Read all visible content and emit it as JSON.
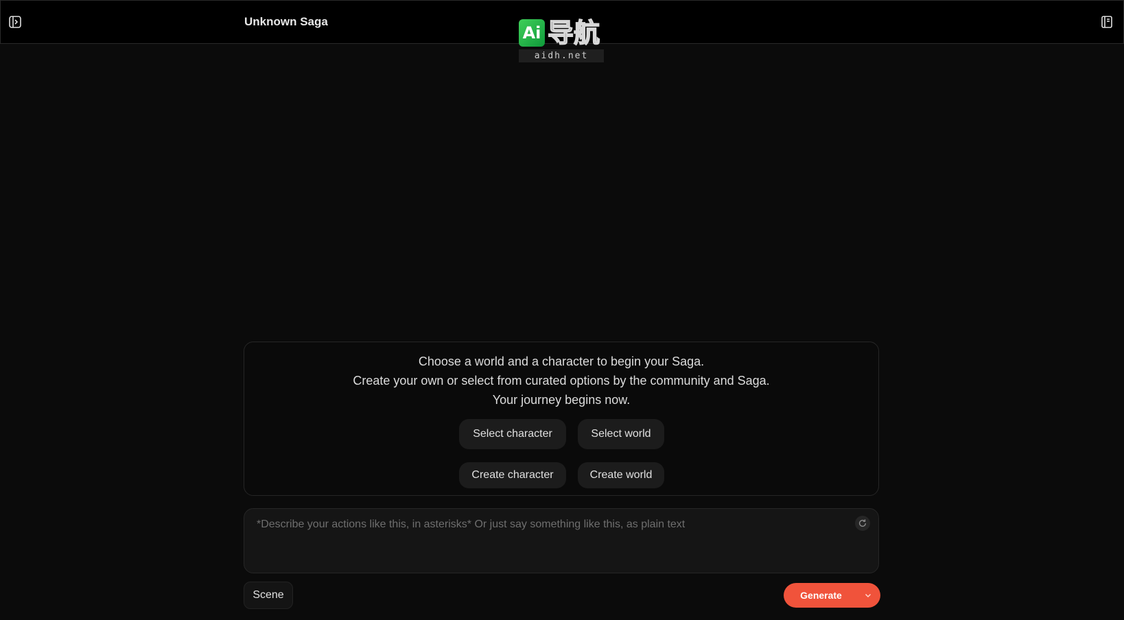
{
  "header": {
    "title": "Unknown Saga",
    "sidebar_toggle_icon": "sidebar-toggle-icon",
    "notes_icon": "notebook-icon"
  },
  "watermark": {
    "badge": "Ai",
    "chinese": "导航",
    "domain": "aidh.net"
  },
  "welcome": {
    "line1": "Choose a world and a character to begin your Saga.",
    "line2": "Create your own or select from curated options by the community and Saga.",
    "line3": "Your journey begins now.",
    "select_character": "Select character",
    "select_world": "Select world",
    "create_character": "Create character",
    "create_world": "Create world"
  },
  "input": {
    "placeholder": "*Describe your actions like this, in asterisks* Or just say something like this, as plain text",
    "value": ""
  },
  "footer": {
    "scene_label": "Scene",
    "generate_label": "Generate"
  },
  "colors": {
    "background": "#0b0b0b",
    "accent": "#f0533b",
    "card_border": "#262626",
    "button_bg": "#1c1c1c"
  }
}
